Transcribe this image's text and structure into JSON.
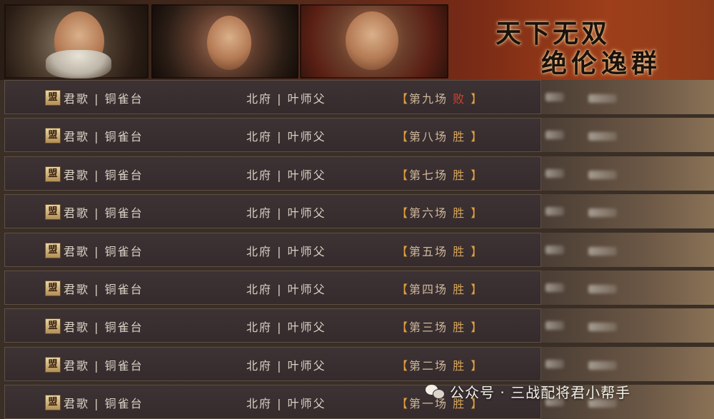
{
  "banner": {
    "slogan_line1": "天下无双",
    "slogan_line2": "绝伦逸群"
  },
  "rows": [
    {
      "flag": "盟",
      "alliance": "君歌 | 铜雀台",
      "player": "北府 | 叶师父",
      "bracket_l": "【",
      "match": "第九场",
      "result": "败",
      "bracket_r": "】",
      "won": false
    },
    {
      "flag": "盟",
      "alliance": "君歌 | 铜雀台",
      "player": "北府 | 叶师父",
      "bracket_l": "【",
      "match": "第八场",
      "result": "胜",
      "bracket_r": "】",
      "won": true
    },
    {
      "flag": "盟",
      "alliance": "君歌 | 铜雀台",
      "player": "北府 | 叶师父",
      "bracket_l": "【",
      "match": "第七场",
      "result": "胜",
      "bracket_r": "】",
      "won": true
    },
    {
      "flag": "盟",
      "alliance": "君歌 | 铜雀台",
      "player": "北府 | 叶师父",
      "bracket_l": "【",
      "match": "第六场",
      "result": "胜",
      "bracket_r": "】",
      "won": true
    },
    {
      "flag": "盟",
      "alliance": "君歌 | 铜雀台",
      "player": "北府 | 叶师父",
      "bracket_l": "【",
      "match": "第五场",
      "result": "胜",
      "bracket_r": "】",
      "won": true
    },
    {
      "flag": "盟",
      "alliance": "君歌 | 铜雀台",
      "player": "北府 | 叶师父",
      "bracket_l": "【",
      "match": "第四场",
      "result": "胜",
      "bracket_r": "】",
      "won": true
    },
    {
      "flag": "盟",
      "alliance": "君歌 | 铜雀台",
      "player": "北府 | 叶师父",
      "bracket_l": "【",
      "match": "第三场",
      "result": "胜",
      "bracket_r": "】",
      "won": true
    },
    {
      "flag": "盟",
      "alliance": "君歌 | 铜雀台",
      "player": "北府 | 叶师父",
      "bracket_l": "【",
      "match": "第二场",
      "result": "胜",
      "bracket_r": "】",
      "won": true
    },
    {
      "flag": "盟",
      "alliance": "君歌 | 铜雀台",
      "player": "北府 | 叶师父",
      "bracket_l": "【",
      "match": "第一场",
      "result": "胜",
      "bracket_r": "】",
      "won": true
    }
  ],
  "watermark": {
    "icon": "wechat-icon",
    "text": "公众号 · 三战配将君小帮手"
  },
  "colors": {
    "win": "#d4a35a",
    "lose": "#d9412c",
    "bracket": "#e2a040"
  }
}
